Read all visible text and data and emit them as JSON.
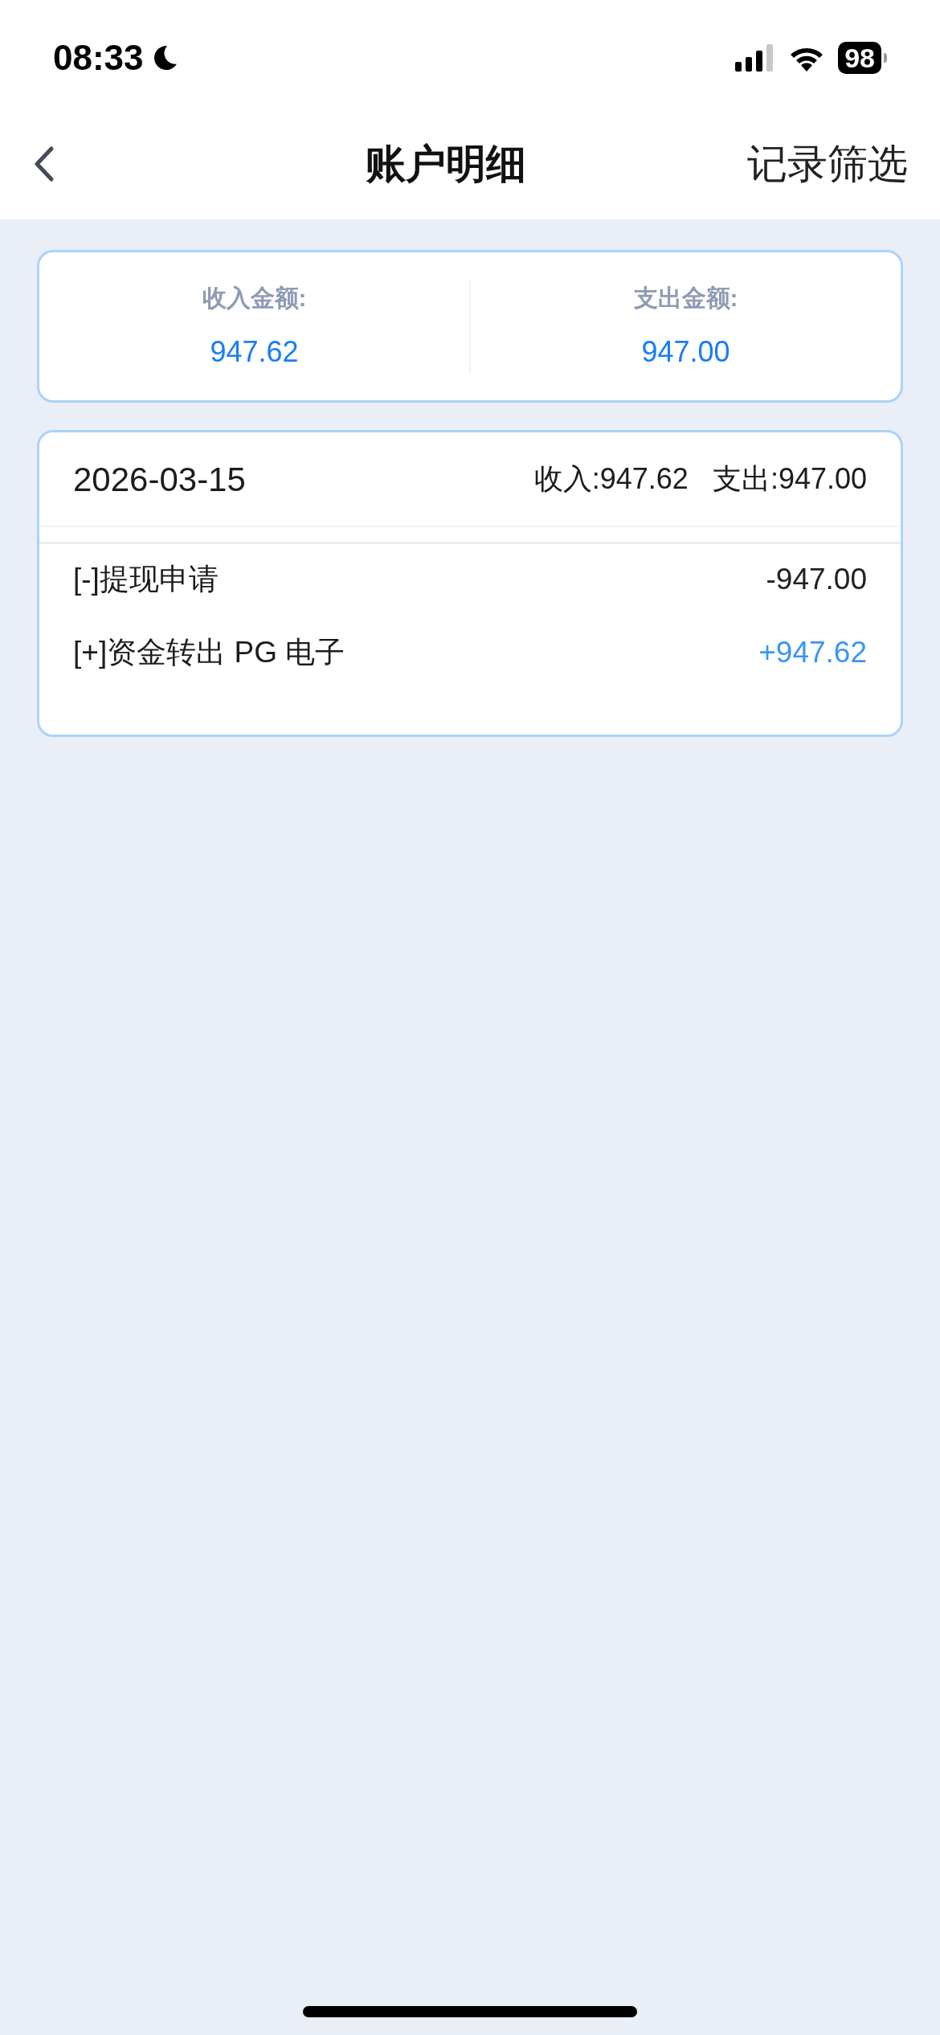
{
  "status_bar": {
    "time": "08:33",
    "battery": "98"
  },
  "nav": {
    "title": "账户明细",
    "action": "记录筛选"
  },
  "summary": [
    {
      "label": "收入金额:",
      "value": "947.62"
    },
    {
      "label": "支出金额:",
      "value": "947.00"
    }
  ],
  "days": [
    {
      "date": "2026-03-15",
      "income": "收入:947.62",
      "expense": "支出:947.00",
      "records": [
        {
          "kind": "expense",
          "title": "[-]提现申请",
          "amount": "-947.00"
        },
        {
          "kind": "income",
          "title": "[+]资金转出 PG 电子",
          "amount": "+947.62"
        }
      ]
    }
  ]
}
